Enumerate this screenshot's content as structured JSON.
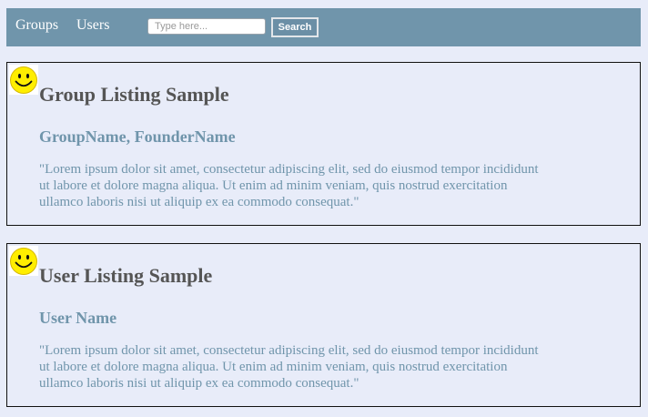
{
  "nav": {
    "groups_label": "Groups",
    "users_label": "Users"
  },
  "search": {
    "placeholder": "Type here...",
    "value": "",
    "button_label": "Search"
  },
  "panels": [
    {
      "icon": "smiley-icon",
      "title": "Group Listing Sample",
      "subtitle": "GroupName, FounderName",
      "body": "\"Lorem ipsum dolor sit amet, consectetur adipiscing elit, sed do eiusmod tempor incididunt ut labore et dolore magna aliqua. Ut enim ad minim veniam, quis nostrud exercitation ullamco laboris nisi ut aliquip ex ea commodo consequat.\""
    },
    {
      "icon": "smiley-icon",
      "title": "User Listing Sample",
      "subtitle": "User Name",
      "body": "\"Lorem ipsum dolor sit amet, consectetur adipiscing elit, sed do eiusmod tempor incididunt ut labore et dolore magna aliqua. Ut enim ad minim veniam, quis nostrud exercitation ullamco laboris nisi ut aliquip ex ea commodo consequat.\""
    }
  ],
  "colors": {
    "page_background": "#e8ecf9",
    "navbar_background": "#7095ab",
    "title_text": "#555555",
    "accent_text": "#7095ab",
    "smiley_face": "#ffee00"
  }
}
